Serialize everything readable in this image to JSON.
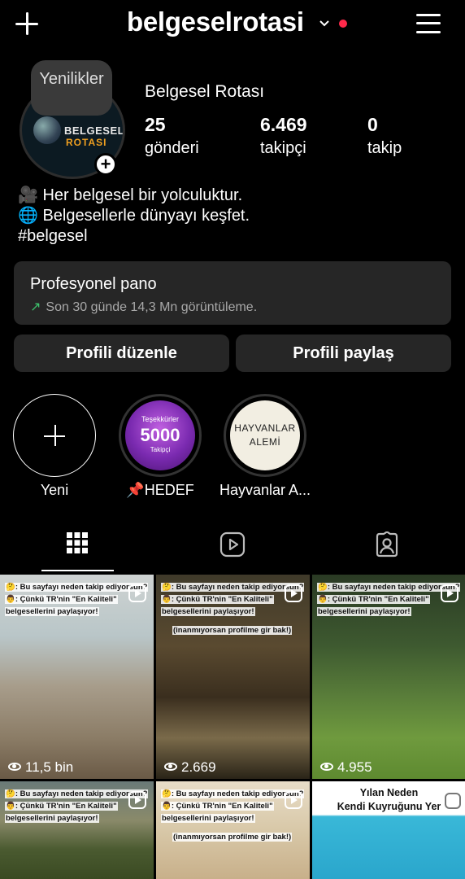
{
  "header": {
    "username": "belgeselrotasi",
    "icons": [
      "plus-icon",
      "chevron-down-icon",
      "notification-dot",
      "menu-icon"
    ]
  },
  "profile": {
    "note": "Yenilikler",
    "logo_line1": "BELGESEL",
    "logo_line2": "ROTASI",
    "display_name": "Belgesel Rotası",
    "stats": [
      {
        "value": "25",
        "label": "gönderi"
      },
      {
        "value": "6.469",
        "label": "takipçi"
      },
      {
        "value": "0",
        "label": "takip"
      }
    ],
    "bio": [
      "🎥 Her belgesel bir yolculuktur.",
      "🌐 Belgesellerle dünyayı keşfet.",
      "#belgesel"
    ]
  },
  "dashboard": {
    "title": "Profesyonel pano",
    "subtitle": "Son 30 günde 14,3 Mn görüntüleme."
  },
  "buttons": {
    "edit": "Profili düzenle",
    "share": "Profili paylaş"
  },
  "highlights": [
    {
      "label": "Yeni"
    },
    {
      "label": "📌HEDEF",
      "cover_line1": "Teşekkürler",
      "cover_line2": "5000",
      "cover_line3": "Takipçi"
    },
    {
      "label": "Hayvanlar A...",
      "cover_line1": "HAYVANLAR",
      "cover_line2": "ALEMİ"
    }
  ],
  "tabs": [
    "grid-icon",
    "reels-icon",
    "tagged-icon"
  ],
  "posts": [
    {
      "line1": "🤔: Bu sayfayı neden takip ediyorsun?",
      "line2": "👨: Çünkü TR'nin \"En Kaliteli\"",
      "line3": "belgesellerini paylaşıyor!",
      "views": "11,5 bin"
    },
    {
      "line1": "🤔: Bu sayfayı neden takip ediyorsun?",
      "line2": "👨: Çünkü TR'nin \"En Kaliteli\"",
      "line3": "belgesellerini paylaşıyor!",
      "line4": "(inanmıyorsan profilme gir bak!)",
      "views": "2.669"
    },
    {
      "line1": "🤔: Bu sayfayı neden takip ediyorsun?",
      "line2": "👨: Çünkü TR'nin \"En Kaliteli\"",
      "line3": "belgesellerini paylaşıyor!",
      "views": "4.955"
    },
    {
      "line1": "🤔: Bu sayfayı neden takip ediyorsun?",
      "line2": "👨: Çünkü TR'nin \"En Kaliteli\"",
      "line3": "belgesellerini paylaşıyor!"
    },
    {
      "line1": "🤔: Bu sayfayı neden takip ediyorsun?",
      "line2": "👨: Çünkü TR'nin \"En Kaliteli\"",
      "line3": "belgesellerini paylaşıyor!",
      "line4": "(inanmıyorsan profilme gir bak!)"
    },
    {
      "line1": "Yılan Neden",
      "line2": "Kendi Kuyruğunu Yer"
    }
  ]
}
